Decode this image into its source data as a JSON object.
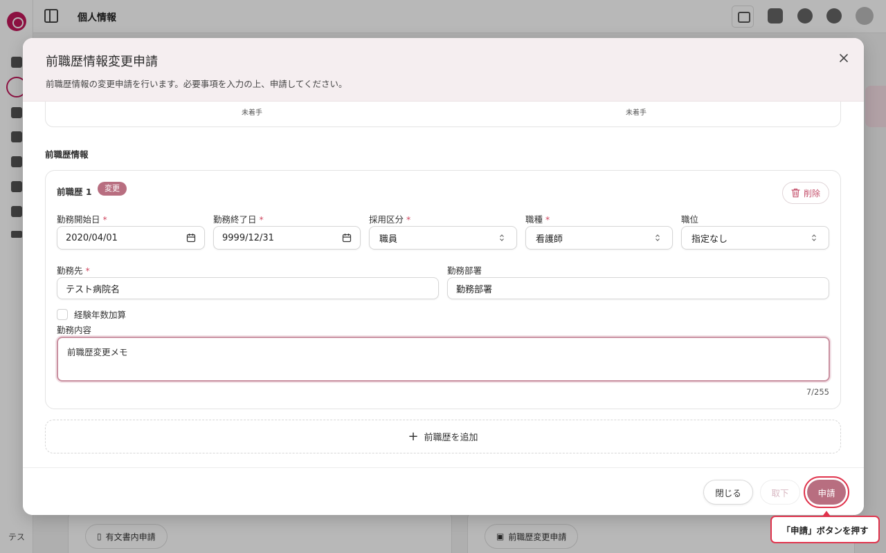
{
  "background": {
    "page_title": "個人情報",
    "rail_bottom_label": "テス",
    "bottom_left_button": "有文書内申請",
    "bottom_right_button": "前職歴変更申請"
  },
  "modal": {
    "title": "前職歴情報変更申請",
    "description": "前職歴情報の変更申請を行います。必要事項を入力の上、申請してください。",
    "prev_card": {
      "status_left": "未着手",
      "status_right": "未着手"
    },
    "section_title": "前職歴情報",
    "entry": {
      "title": "前職歴 1",
      "badge": "変更",
      "delete_label": "削除",
      "fields": {
        "start_date": {
          "label": "勤務開始日",
          "value": "2020/04/01"
        },
        "end_date": {
          "label": "勤務終了日",
          "value": "9999/12/31"
        },
        "employment_type": {
          "label": "採用区分",
          "value": "職員"
        },
        "job_type": {
          "label": "職種",
          "value": "看護師"
        },
        "position": {
          "label": "職位",
          "value": "指定なし"
        },
        "workplace": {
          "label": "勤務先",
          "value": "テスト病院名"
        },
        "department": {
          "label": "勤務部署",
          "value": "勤務部署"
        },
        "experience_checkbox": {
          "label": "経験年数加算",
          "checked": false
        },
        "duties": {
          "label": "勤務内容",
          "value": "前職歴変更メモ",
          "counter": "7/255"
        }
      },
      "required_mark": "*"
    },
    "add_label": "前職歴を追加",
    "footer": {
      "close_label": "閉じる",
      "withdraw_label": "取下",
      "submit_label": "申請"
    }
  },
  "tooltip": {
    "text": "「申請」ボタンを押す"
  },
  "colors": {
    "accent": "#b86e80",
    "highlight": "#e0334c",
    "header_bg": "#f5eef0"
  }
}
